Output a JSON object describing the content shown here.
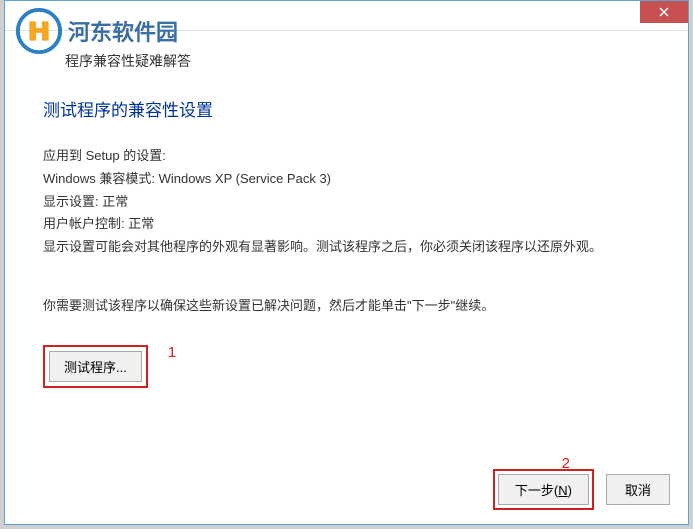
{
  "watermark": {
    "text": "河东软件园"
  },
  "header": {
    "title": "程序兼容性疑难解答"
  },
  "content": {
    "heading": "测试程序的兼容性设置",
    "setting_applied": "应用到  Setup 的设置:",
    "compat_mode": "Windows 兼容模式: Windows XP (Service Pack 3)",
    "display_setting": "显示设置: 正常",
    "uac_setting": "用户帐户控制: 正常",
    "description": "显示设置可能会对其他程序的外观有显著影响。测试该程序之后，你必须关闭该程序以还原外观。",
    "instruction": "你需要测试该程序以确保这些新设置已解决问题，然后才能单击\"下一步\"继续。",
    "test_button_label": "测试程序...",
    "annotation_1": "1"
  },
  "footer": {
    "annotation_2": "2",
    "next_label_prefix": "下一步(",
    "next_label_key": "N",
    "next_label_suffix": ")",
    "cancel_label": "取消"
  }
}
